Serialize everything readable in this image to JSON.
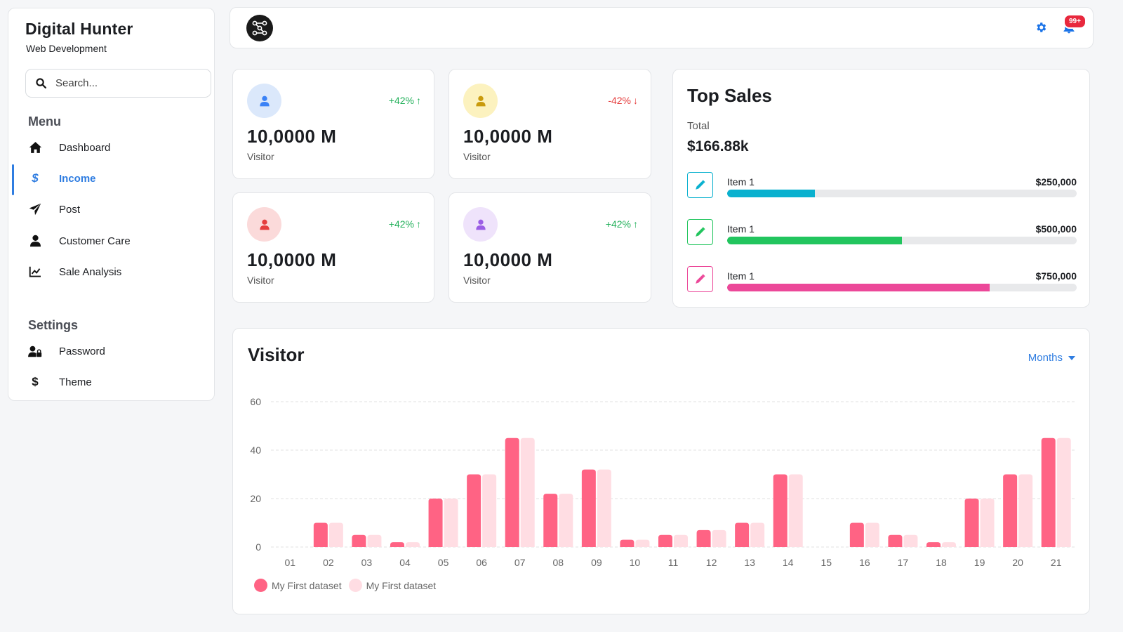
{
  "brand": {
    "title": "Digital Hunter",
    "subtitle": "Web Development"
  },
  "search": {
    "placeholder": "Search..."
  },
  "menu": {
    "title": "Menu",
    "items": [
      {
        "label": "Dashboard",
        "icon": "home-icon"
      },
      {
        "label": "Income",
        "icon": "dollar-icon",
        "active": true
      },
      {
        "label": "Post",
        "icon": "paper-plane-icon"
      },
      {
        "label": "Customer Care",
        "icon": "user-icon"
      },
      {
        "label": "Sale Analysis",
        "icon": "line-chart-icon"
      }
    ]
  },
  "settings": {
    "title": "Settings",
    "items": [
      {
        "label": "Password",
        "icon": "user-lock-icon"
      },
      {
        "label": "Theme",
        "icon": "dollar-icon"
      }
    ]
  },
  "topbar": {
    "notification_count": "99+",
    "logo_icon": "network-logo-icon",
    "gear_icon": "gear-icon",
    "bell_icon": "bell-icon"
  },
  "stats": [
    {
      "value": "10,0000 M",
      "label": "Visitor",
      "delta": "+42%",
      "direction": "up",
      "avatar_color": "#3b82f6",
      "avatar_bg": "#dbe8fb"
    },
    {
      "value": "10,0000 M",
      "label": "Visitor",
      "delta": "-42%",
      "direction": "down",
      "avatar_color": "#c99a0c",
      "avatar_bg": "#fcf2bf"
    },
    {
      "value": "10,0000 M",
      "label": "Visitor",
      "delta": "+42%",
      "direction": "up",
      "avatar_color": "#e53e3e",
      "avatar_bg": "#fbdada"
    },
    {
      "value": "10,0000 M",
      "label": "Visitor",
      "delta": "+42%",
      "direction": "up",
      "avatar_color": "#9b5de5",
      "avatar_bg": "#efe3fb"
    }
  ],
  "top_sales": {
    "title": "Top Sales",
    "total_label": "Total",
    "total_value": "$166.88k",
    "items": [
      {
        "name": "Item 1",
        "amount": "$250,000",
        "progress": 0.25,
        "color": "#0ab1cf",
        "icon": "pen-icon"
      },
      {
        "name": "Item 1",
        "amount": "$500,000",
        "progress": 0.5,
        "color": "#22c55e",
        "icon": "pen-icon"
      },
      {
        "name": "Item 1",
        "amount": "$750,000",
        "progress": 0.75,
        "color": "#ec4899",
        "icon": "pen-icon"
      }
    ]
  },
  "visitor": {
    "title": "Visitor",
    "period": "Months"
  },
  "chart_data": {
    "type": "bar",
    "categories": [
      "01",
      "02",
      "03",
      "04",
      "05",
      "06",
      "07",
      "08",
      "09",
      "10",
      "11",
      "12",
      "13",
      "14",
      "15",
      "16",
      "17",
      "18",
      "19",
      "20",
      "21"
    ],
    "series": [
      {
        "name": "My First dataset",
        "color": "#ff6384",
        "values": [
          0,
          10,
          5,
          2,
          20,
          30,
          45,
          22,
          32,
          3,
          5,
          7,
          10,
          30,
          0,
          10,
          5,
          2,
          20,
          30,
          45
        ]
      },
      {
        "name": "My First dataset",
        "color": "#ffdde3",
        "values": [
          0,
          10,
          5,
          2,
          20,
          30,
          45,
          22,
          32,
          3,
          5,
          7,
          10,
          30,
          0,
          10,
          5,
          2,
          20,
          30,
          45
        ]
      }
    ],
    "ylim": [
      0,
      60
    ],
    "yticks": [
      0,
      20,
      40,
      60
    ],
    "grid": true,
    "legend": "bottom-left"
  }
}
